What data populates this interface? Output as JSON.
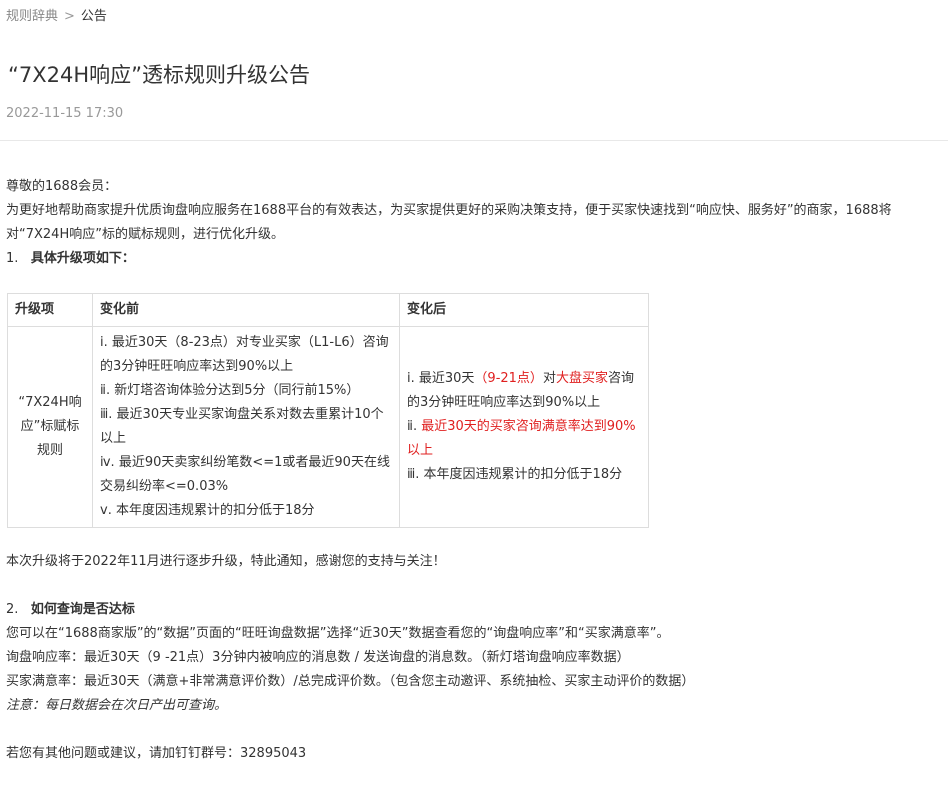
{
  "breadcrumb": {
    "parent": "规则辞典",
    "separator": ">",
    "current": "公告"
  },
  "title": "“7X24H响应”透标规则升级公告",
  "date": "2022-11-15 17:30",
  "intro": {
    "greeting": "尊敬的1688会员：",
    "paragraph": "为更好地帮助商家提升优质询盘响应服务在1688平台的有效表达，为买家提供更好的采购决策支持，便于买家快速找到“响应快、服务好”的商家，1688将对“7X24H响应”标的赋标规则，进行优化升级。"
  },
  "section1": {
    "number": "1.",
    "heading": "具体升级项如下："
  },
  "table": {
    "headers": {
      "item": "升级项",
      "before": "变化前",
      "after": "变化后"
    },
    "item_label": "“7X24H响应”标赋标规则",
    "before": [
      "ⅰ. 最近30天（8-23点）对专业买家（L1-L6）咨询的3分钟旺旺响应率达到90%以上",
      "ⅱ. 新灯塔咨询体验分达到5分（同行前15%）",
      "ⅲ. 最近30天专业买家询盘关系对数去重累计10个以上",
      "ⅳ. 最近90天卖家纠纷笔数<=1或者最近90天在线交易纠纷率<=0.03%",
      "ⅴ. 本年度因违规累计的扣分低于18分"
    ],
    "after": {
      "r1_prefix": "ⅰ. 最近30天",
      "r1_red1": "（9-21点）",
      "r1_mid": "对",
      "r1_red2": "大盘买家",
      "r1_suffix": "咨询的3分钟旺旺响应率达到90%以上",
      "r2_prefix": "ⅱ. ",
      "r2_red": "最近30天的买家咨询满意率达到90%以上",
      "r3": "ⅲ. 本年度因违规累计的扣分低于18分"
    }
  },
  "upgrade_notice": "本次升级将于2022年11月进行逐步升级，特此通知，感谢您的支持与关注！",
  "section2": {
    "number": "2.",
    "heading": "如何查询是否达标",
    "line1": "您可以在“1688商家版”的“数据”页面的“旺旺询盘数据”选择“近30天”数据查看您的“询盘响应率”和“买家满意率”。",
    "line2": "询盘响应率：最近30天（9 -21点）3分钟内被响应的消息数 / 发送询盘的消息数。（新灯塔询盘响应率数据）",
    "line3": "买家满意率：最近30天（满意+非常满意评价数）/总完成评价数。（包含您主动邀评、系统抽检、买家主动评价的数据）",
    "note": "注意：每日数据会在次日产出可查询。"
  },
  "contact": "若您有其他问题或建议，请加钉钉群号：32895043",
  "colors": {
    "text": "#333333",
    "muted": "#999999",
    "highlight_red": "#e02020",
    "table_border": "#dddddd"
  }
}
